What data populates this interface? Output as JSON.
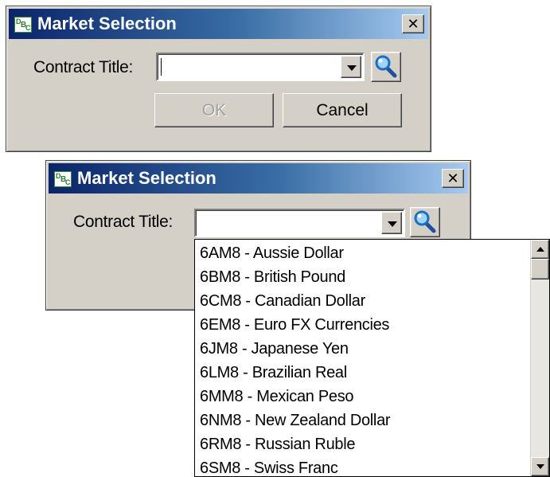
{
  "dialog_top": {
    "title": "Market Selection",
    "close_glyph": "✕",
    "contract_label": "Contract Title:",
    "contract_value": "",
    "ok_label": "OK",
    "cancel_label": "Cancel"
  },
  "dialog_bottom": {
    "title": "Market Selection",
    "close_glyph": "✕",
    "contract_label": "Contract Title:",
    "contract_value": ""
  },
  "app_icon": {
    "letters": [
      "D",
      "B",
      "C"
    ],
    "color": "#2e7d32"
  },
  "icons": {
    "dropdown": "chevron-down-icon",
    "search": "magnifier-search-icon",
    "close": "close-icon"
  },
  "dropdown_items": [
    "6AM8 - Aussie Dollar",
    "6BM8 - British Pound",
    "6CM8 - Canadian Dollar",
    "6EM8 - Euro FX Currencies",
    "6JM8 - Japanese Yen",
    "6LM8 - Brazilian Real",
    "6MM8 - Mexican Peso",
    "6NM8 - New Zealand Dollar",
    "6RM8 - Russian Ruble",
    "6SM8 - Swiss Franc"
  ],
  "colors": {
    "title_gradient_start": "#0a246a",
    "title_gradient_end": "#a6caf0",
    "dialog_face": "#d4d0c8"
  }
}
